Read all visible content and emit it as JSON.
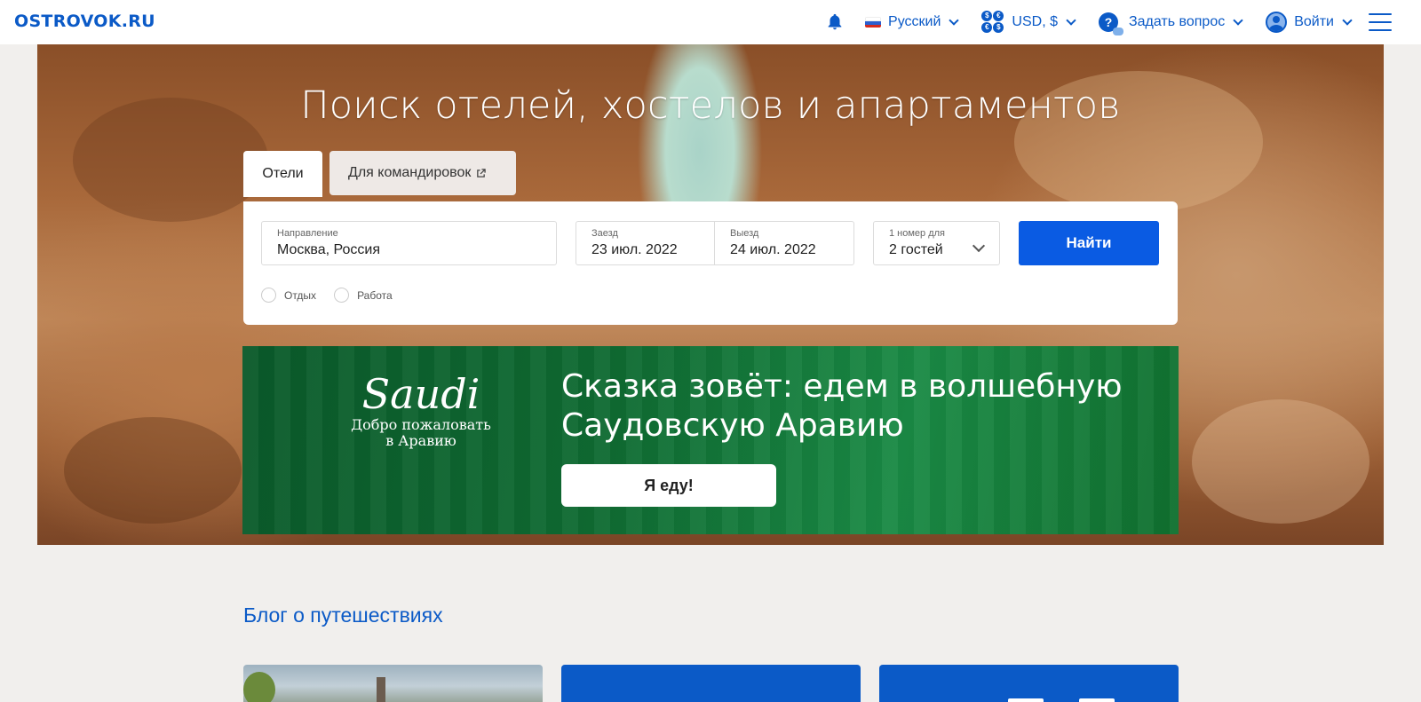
{
  "header": {
    "logo": "OSTROVOK.RU",
    "nav": {
      "language": "Русский",
      "currency": "USD, $",
      "ask_question": "Задать вопрос",
      "login": "Войти"
    },
    "icons": [
      "bell-icon",
      "russian-flag-icon",
      "currency-icon",
      "question-icon",
      "user-icon",
      "menu-icon"
    ]
  },
  "hero": {
    "title": "Поиск отелей, хостелов и апартаментов"
  },
  "tabs": {
    "hotels": "Отели",
    "business": "Для командировок"
  },
  "search": {
    "destination_label": "Направление",
    "destination_value": "Москва, Россия",
    "checkin_label": "Заезд",
    "checkin_value": "23 июл. 2022",
    "checkout_label": "Выезд",
    "checkout_value": "24 июл. 2022",
    "guests_label": "1 номер для",
    "guests_value": "2 гостей",
    "submit": "Найти",
    "trip_types": [
      "Отдых",
      "Работа"
    ]
  },
  "banner": {
    "logo_text": "Saudi",
    "logo_subtitle_1": "Добро пожаловать",
    "logo_subtitle_2": "в Аравию",
    "headline": "Сказка зовёт: едем в волшебную Саудовскую Аравию",
    "button": "Я еду!"
  },
  "blog": {
    "title": "Блог о путешествиях"
  },
  "colors": {
    "brand": "#0b5ac7",
    "search_button": "#0a5be3",
    "banner_green": "#0f6b32",
    "page_bg": "#f1efed"
  }
}
